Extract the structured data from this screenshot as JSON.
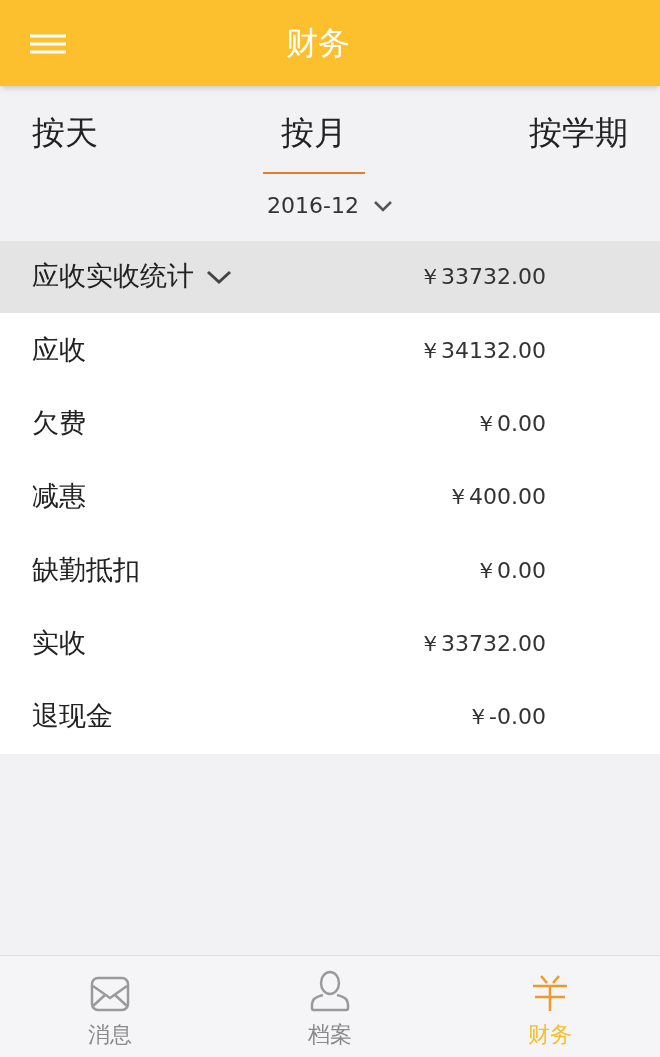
{
  "header": {
    "title": "财务"
  },
  "tabs": [
    {
      "label": "按天",
      "selected": false
    },
    {
      "label": "按月",
      "selected": true
    },
    {
      "label": "按学期",
      "selected": false
    }
  ],
  "period": {
    "value": "2016-12"
  },
  "summary": {
    "label": "应收实收统计",
    "expanded": true,
    "amount": "￥33732.00"
  },
  "rows": [
    {
      "label": "应收",
      "amount": "￥34132.00"
    },
    {
      "label": "欠费",
      "amount": "￥0.00"
    },
    {
      "label": "减惠",
      "amount": "￥400.00"
    },
    {
      "label": "缺勤抵扣",
      "amount": "￥0.00"
    },
    {
      "label": "实收",
      "amount": "￥33732.00"
    },
    {
      "label": "退现金",
      "amount": "￥-0.00"
    }
  ],
  "bottom_nav": [
    {
      "kind": "mail",
      "label": "消息",
      "selected": false
    },
    {
      "kind": "person",
      "label": "档案",
      "selected": false
    },
    {
      "kind": "yen",
      "label": "财务",
      "selected": true
    }
  ]
}
